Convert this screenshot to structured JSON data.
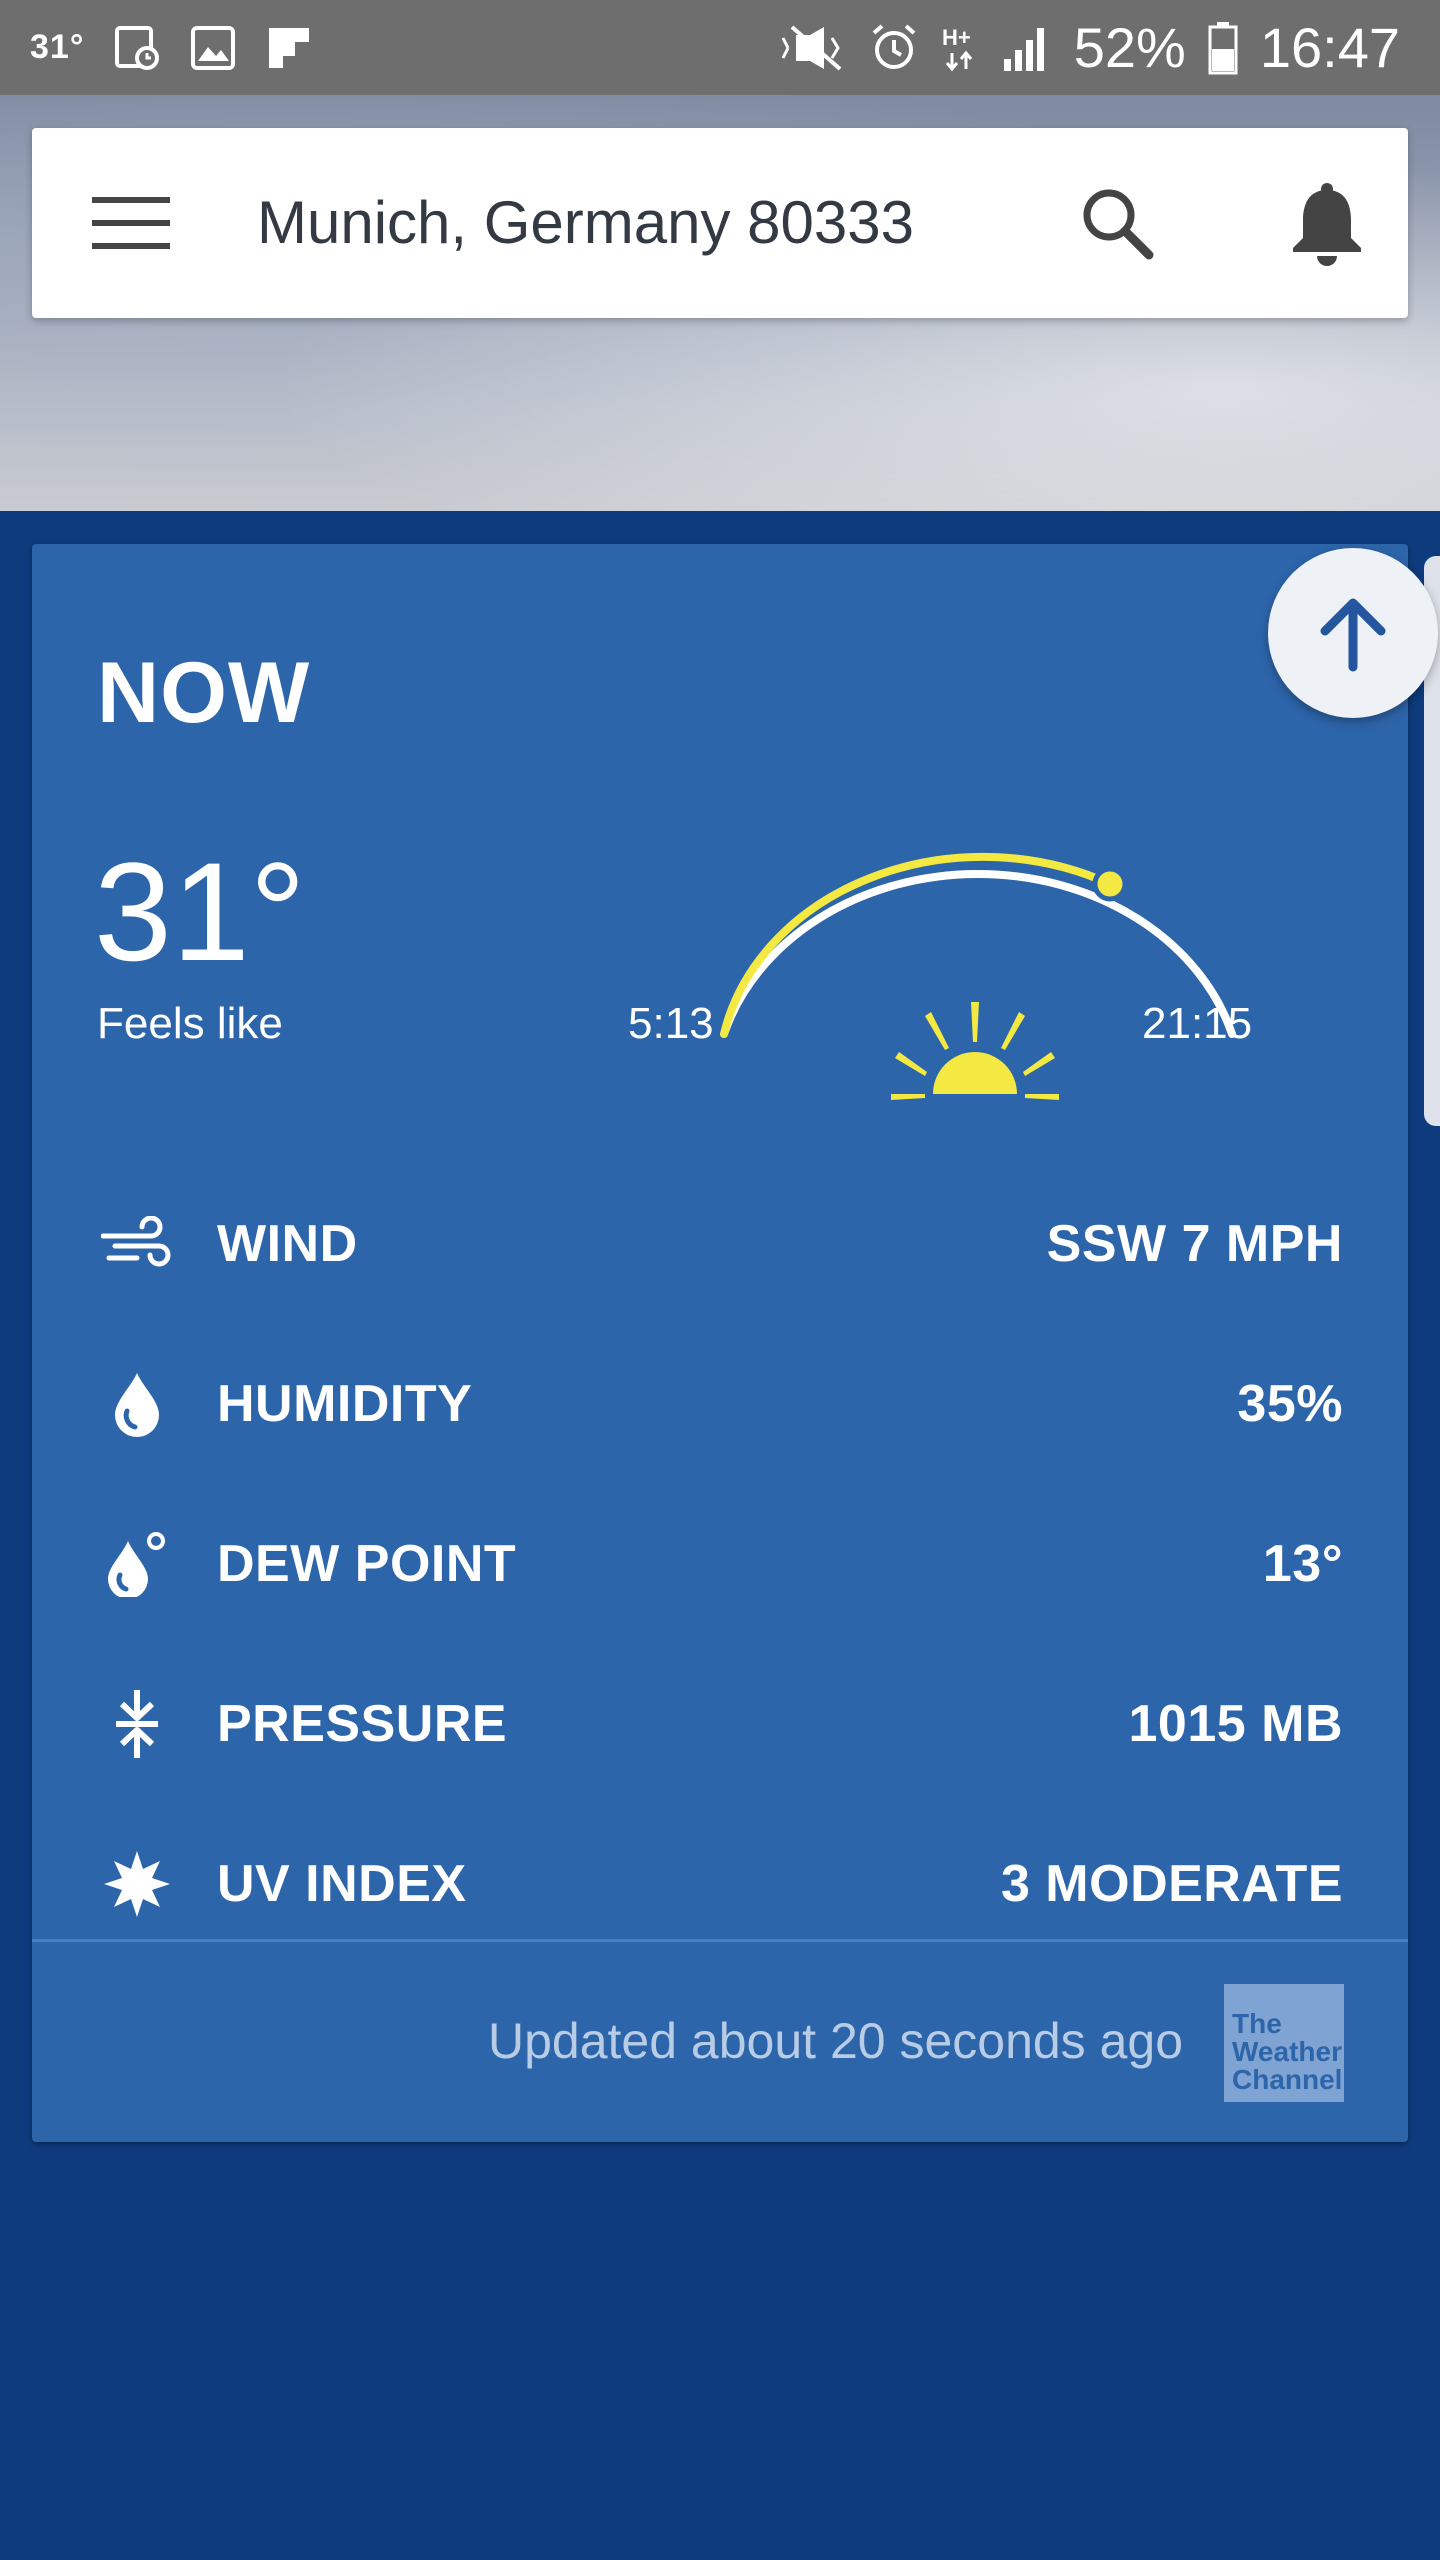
{
  "status_bar": {
    "temp": "31°",
    "battery": "52%",
    "time": "16:47",
    "icons": [
      "calendar-icon",
      "image-icon",
      "flipboard-icon",
      "mute-icon",
      "alarm-icon",
      "hplus-icon",
      "signal-icon",
      "battery-icon"
    ]
  },
  "search_bar": {
    "location": "Munich, Germany 80333",
    "icons": [
      "menu-icon",
      "search-icon",
      "bell-icon"
    ]
  },
  "now_card": {
    "title": "NOW",
    "temperature": "31°",
    "feels_like": "Feels like",
    "sunrise": "5:13",
    "sunset": "21:15",
    "details": [
      {
        "icon": "wind-icon",
        "label": "WIND",
        "value": "SSW 7 MPH"
      },
      {
        "icon": "humidity-icon",
        "label": "HUMIDITY",
        "value": "35%"
      },
      {
        "icon": "dew-point-icon",
        "label": "DEW POINT",
        "value": "13°"
      },
      {
        "icon": "pressure-icon",
        "label": "PRESSURE",
        "value": "1015 MB"
      },
      {
        "icon": "uv-index-icon",
        "label": "UV INDEX",
        "value": "3 MODERATE"
      }
    ],
    "updated": "Updated about 20 seconds ago",
    "logo_text": "The Weather Channel"
  },
  "colors": {
    "page_bg": "#0e3b7d",
    "card_bg": "#2d65aa",
    "sun_yellow": "#f4e842",
    "status_bar": "#6e6e6e"
  }
}
